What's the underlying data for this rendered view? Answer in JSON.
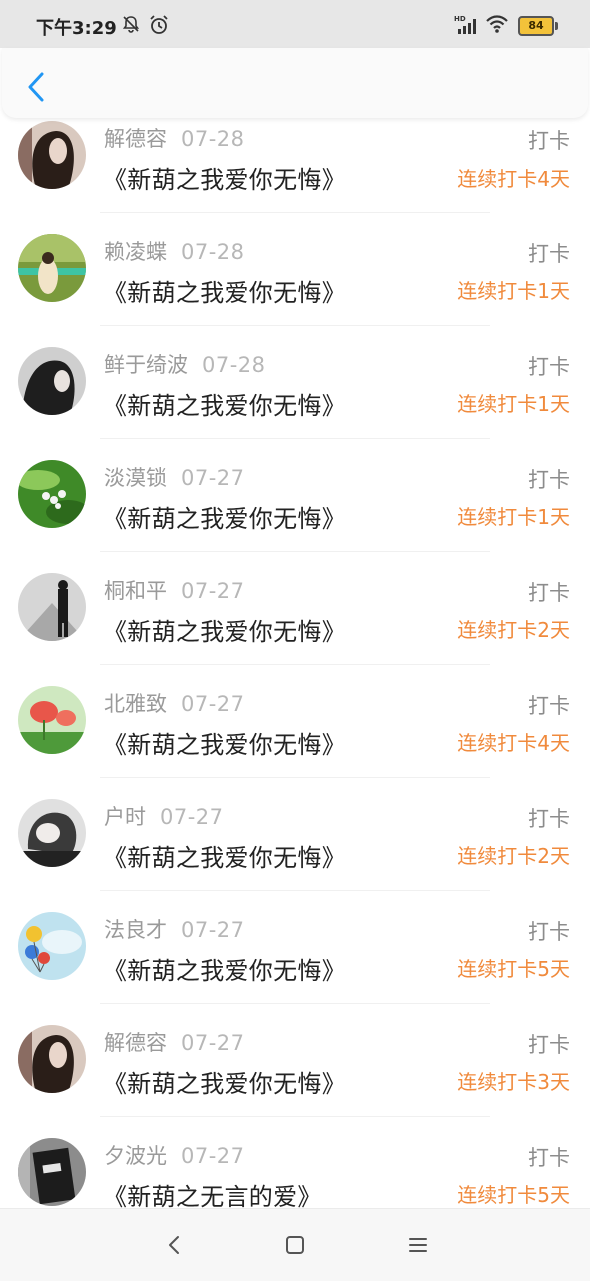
{
  "status_bar": {
    "time": "下午3:29",
    "battery": "84",
    "icons": [
      "mute-bell-icon",
      "alarm-icon",
      "hd-signal-icon",
      "wifi-icon",
      "battery-icon"
    ]
  },
  "header": {
    "back_icon": "chevron-left-icon"
  },
  "colors": {
    "accent": "#2196f3",
    "streak": "#f08a3c",
    "meta": "#9a9a9a",
    "title": "#222222"
  },
  "items": [
    {
      "name": "解德容",
      "date": "07-28",
      "title": "《新葫之我爱你无悔》",
      "action": "打卡",
      "streak": "连续打卡4天"
    },
    {
      "name": "赖凌蝶",
      "date": "07-28",
      "title": "《新葫之我爱你无悔》",
      "action": "打卡",
      "streak": "连续打卡1天"
    },
    {
      "name": "鲜于绮波",
      "date": "07-28",
      "title": "《新葫之我爱你无悔》",
      "action": "打卡",
      "streak": "连续打卡1天"
    },
    {
      "name": "淡漠锁",
      "date": "07-27",
      "title": "《新葫之我爱你无悔》",
      "action": "打卡",
      "streak": "连续打卡1天"
    },
    {
      "name": "桐和平",
      "date": "07-27",
      "title": "《新葫之我爱你无悔》",
      "action": "打卡",
      "streak": "连续打卡2天"
    },
    {
      "name": "北雅致",
      "date": "07-27",
      "title": "《新葫之我爱你无悔》",
      "action": "打卡",
      "streak": "连续打卡4天"
    },
    {
      "name": "户时",
      "date": "07-27",
      "title": "《新葫之我爱你无悔》",
      "action": "打卡",
      "streak": "连续打卡2天"
    },
    {
      "name": "法良才",
      "date": "07-27",
      "title": "《新葫之我爱你无悔》",
      "action": "打卡",
      "streak": "连续打卡5天"
    },
    {
      "name": "解德容",
      "date": "07-27",
      "title": "《新葫之我爱你无悔》",
      "action": "打卡",
      "streak": "连续打卡3天"
    },
    {
      "name": "夕波光",
      "date": "07-27",
      "title": "《新葫之无言的爱》",
      "action": "打卡",
      "streak": "连续打卡5天"
    }
  ],
  "bottom_nav": [
    "back-triangle-icon",
    "home-square-icon",
    "menu-lines-icon"
  ]
}
